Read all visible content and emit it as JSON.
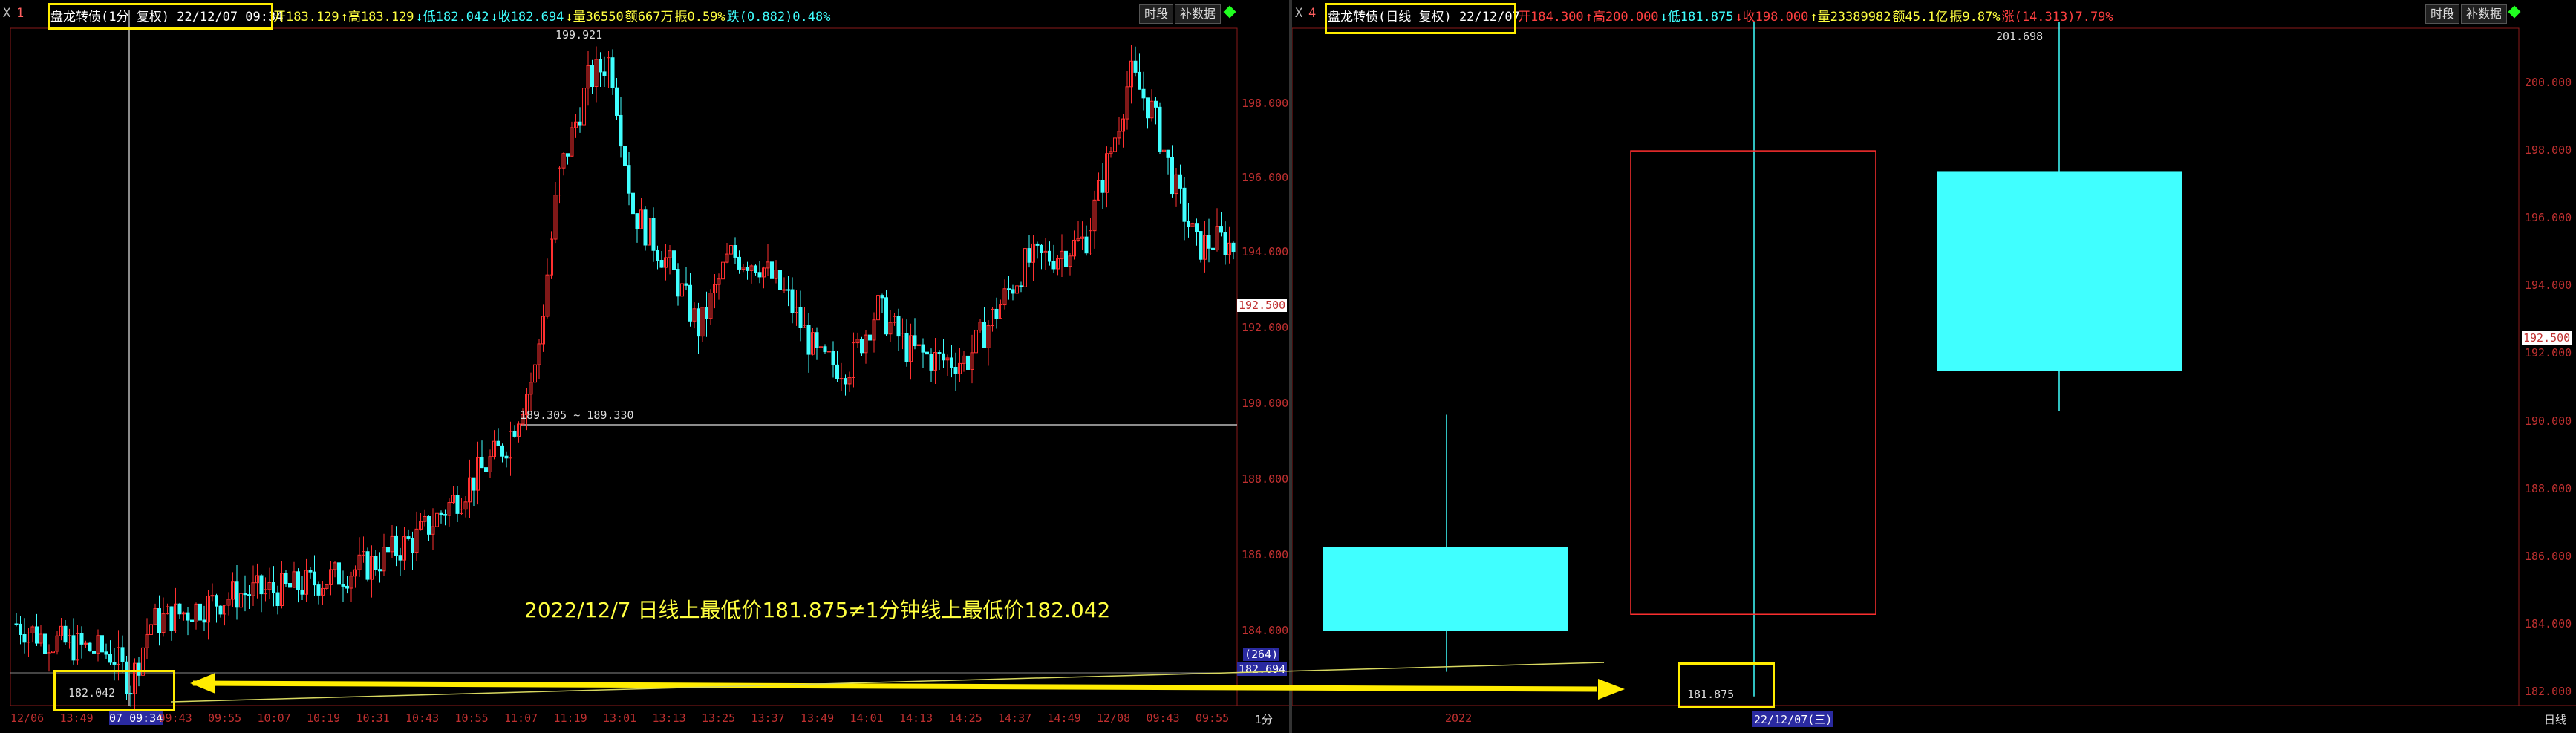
{
  "left": {
    "window_close": "X",
    "window_label": "1",
    "title_box": "盘龙转债(1分 复权) 22/12/07 09:34",
    "stats": [
      {
        "label": "开183.129",
        "color": "#ffff40"
      },
      {
        "label": "↑高183.129",
        "color": "#ffff40"
      },
      {
        "label": "↓低182.042",
        "color": "#40ffff"
      },
      {
        "label": "↓收182.694",
        "color": "#40ffff"
      },
      {
        "label": "↓量36550",
        "color": "#ffff40"
      },
      {
        "label": "额667万",
        "color": "#ffff40"
      },
      {
        "label": "振0.59%",
        "color": "#ffff40"
      },
      {
        "label": "跌(0.882)0.48%",
        "color": "#40ffff"
      }
    ],
    "btn_timeframe": "时段",
    "btn_tick": "补数据",
    "peak_label": "199.921",
    "range_label": "189.305 ~ 189.330",
    "low_label": "182.042",
    "price_tag": "192.500",
    "vol_tag": "(264)",
    "close_tag": "182.694",
    "y_axis": [
      "198.000",
      "196.000",
      "194.000",
      "192.000",
      "190.000",
      "188.000",
      "186.000",
      "184.000"
    ],
    "x_axis": [
      "12/06",
      "13:49",
      "07 09:34",
      "09:43",
      "09:55",
      "10:07",
      "10:19",
      "10:31",
      "10:43",
      "10:55",
      "11:07",
      "11:19",
      "13:01",
      "13:13",
      "13:25",
      "13:37",
      "13:49",
      "14:01",
      "14:13",
      "14:25",
      "14:37",
      "14:49",
      "12/08",
      "09:43",
      "09:55"
    ],
    "period_label": "1分",
    "annotation": "2022/12/7 日线上最低价181.875≠1分钟线上最低价182.042"
  },
  "right": {
    "window_close": "X",
    "window_label": "4",
    "title_box": "盘龙转债(日线 复权) 22/12/07",
    "stats": [
      {
        "label": "开184.300",
        "color": "#ff4040"
      },
      {
        "label": "↑高200.000",
        "color": "#ff4040"
      },
      {
        "label": "↓低181.875",
        "color": "#40ffff"
      },
      {
        "label": "↓收198.000",
        "color": "#ff4040"
      },
      {
        "label": "↑量23389982",
        "color": "#ffff40"
      },
      {
        "label": "额45.1亿",
        "color": "#ffff40"
      },
      {
        "label": "振9.87%",
        "color": "#ffff40"
      },
      {
        "label": "涨(14.313)7.79%",
        "color": "#ff4040"
      }
    ],
    "btn_timeframe": "时段",
    "btn_tick": "补数据",
    "peak_label": "201.698",
    "low_label": "181.875",
    "price_tag": "192.500",
    "y_axis": [
      "200.000",
      "198.000",
      "196.000",
      "194.000",
      "192.000",
      "190.000",
      "188.000",
      "186.000",
      "184.000",
      "182.000"
    ],
    "x_axis_year": "2022",
    "x_axis_date": "22/12/07(三)",
    "period_label": "日线"
  },
  "colors": {
    "up": "#ff3030",
    "down": "#40ffff",
    "highlight": "#ffec00",
    "axis": "#c03030"
  }
}
